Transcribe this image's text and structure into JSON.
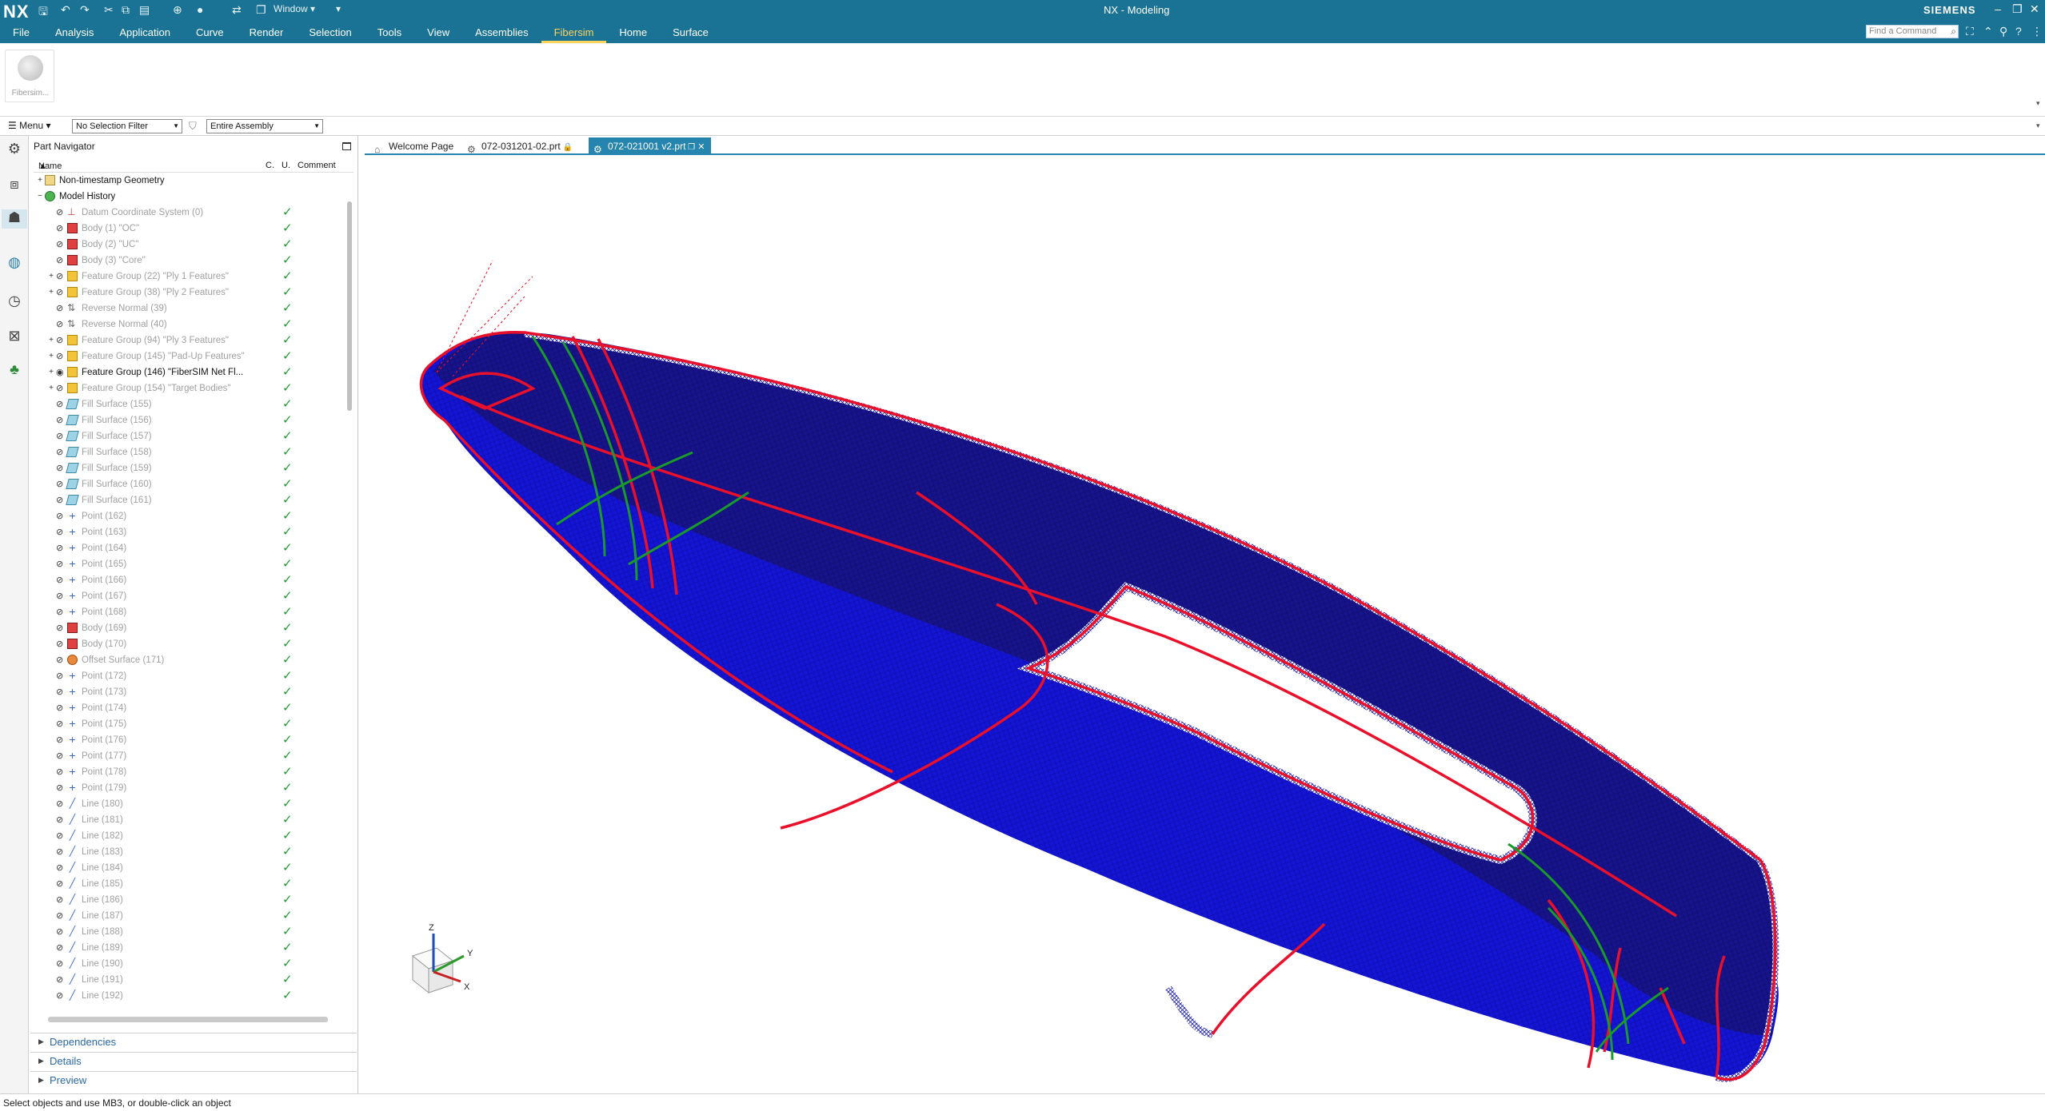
{
  "titlebar": {
    "logo": "NX",
    "window_menu": "Window",
    "app_title": "NX - Modeling",
    "brand": "SIEMENS",
    "find_command_placeholder": "Find a Command"
  },
  "menu_tabs": [
    "File",
    "Analysis",
    "Application",
    "Curve",
    "Render",
    "Selection",
    "Tools",
    "View",
    "Assemblies",
    "Fibersim",
    "Home",
    "Surface"
  ],
  "active_tab": "Fibersim",
  "ribbon": {
    "fibersim_button": "Fibersim..."
  },
  "selection_bar": {
    "menu_label": "Menu",
    "filter": "No Selection Filter",
    "scope": "Entire Assembly"
  },
  "part_navigator": {
    "title": "Part Navigator",
    "columns": {
      "name": "Name",
      "c": "C.",
      "u": "U.",
      "comment": "Comment"
    },
    "rows": [
      {
        "name": "Non-timestamp Geometry",
        "icon": "folder",
        "indent": 0,
        "exp": "+",
        "active": true,
        "check": false
      },
      {
        "name": "Model History",
        "icon": "hist",
        "indent": 0,
        "exp": "−",
        "active": true,
        "check": false
      },
      {
        "name": "Datum Coordinate System (0)",
        "icon": "datum",
        "indent": 1,
        "exp": "",
        "active": false,
        "check": true
      },
      {
        "name": "Body (1) \"OC\"",
        "icon": "body",
        "indent": 1,
        "exp": "",
        "active": false,
        "check": true
      },
      {
        "name": "Body (2) \"UC\"",
        "icon": "body",
        "indent": 1,
        "exp": "",
        "active": false,
        "check": true
      },
      {
        "name": "Body (3) \"Core\"",
        "icon": "body",
        "indent": 1,
        "exp": "",
        "active": false,
        "check": true
      },
      {
        "name": "Feature Group (22) \"Ply 1 Features\"",
        "icon": "feat",
        "indent": 1,
        "exp": "+",
        "active": false,
        "check": true
      },
      {
        "name": "Feature Group (38) \"Ply 2 Features\"",
        "icon": "feat",
        "indent": 1,
        "exp": "+",
        "active": false,
        "check": true
      },
      {
        "name": "Reverse Normal (39)",
        "icon": "rev",
        "indent": 1,
        "exp": "",
        "active": false,
        "check": true
      },
      {
        "name": "Reverse Normal (40)",
        "icon": "rev",
        "indent": 1,
        "exp": "",
        "active": false,
        "check": true
      },
      {
        "name": "Feature Group (94) \"Ply 3 Features\"",
        "icon": "feat",
        "indent": 1,
        "exp": "+",
        "active": false,
        "check": true
      },
      {
        "name": "Feature Group (145) \"Pad-Up Features\"",
        "icon": "feat",
        "indent": 1,
        "exp": "+",
        "active": false,
        "check": true
      },
      {
        "name": "Feature Group (146) \"FiberSIM Net Fl...",
        "icon": "feat",
        "indent": 1,
        "exp": "+",
        "active": true,
        "check": true
      },
      {
        "name": "Feature Group (154) \"Target Bodies\"",
        "icon": "feat",
        "indent": 1,
        "exp": "+",
        "active": false,
        "check": true
      },
      {
        "name": "Fill Surface (155)",
        "icon": "fill",
        "indent": 1,
        "exp": "",
        "active": false,
        "check": true
      },
      {
        "name": "Fill Surface (156)",
        "icon": "fill",
        "indent": 1,
        "exp": "",
        "active": false,
        "check": true
      },
      {
        "name": "Fill Surface (157)",
        "icon": "fill",
        "indent": 1,
        "exp": "",
        "active": false,
        "check": true
      },
      {
        "name": "Fill Surface (158)",
        "icon": "fill",
        "indent": 1,
        "exp": "",
        "active": false,
        "check": true
      },
      {
        "name": "Fill Surface (159)",
        "icon": "fill",
        "indent": 1,
        "exp": "",
        "active": false,
        "check": true
      },
      {
        "name": "Fill Surface (160)",
        "icon": "fill",
        "indent": 1,
        "exp": "",
        "active": false,
        "check": true
      },
      {
        "name": "Fill Surface (161)",
        "icon": "fill",
        "indent": 1,
        "exp": "",
        "active": false,
        "check": true
      },
      {
        "name": "Point (162)",
        "icon": "pt",
        "indent": 1,
        "exp": "",
        "active": false,
        "check": true
      },
      {
        "name": "Point (163)",
        "icon": "pt",
        "indent": 1,
        "exp": "",
        "active": false,
        "check": true
      },
      {
        "name": "Point (164)",
        "icon": "pt",
        "indent": 1,
        "exp": "",
        "active": false,
        "check": true
      },
      {
        "name": "Point (165)",
        "icon": "pt",
        "indent": 1,
        "exp": "",
        "active": false,
        "check": true
      },
      {
        "name": "Point (166)",
        "icon": "pt",
        "indent": 1,
        "exp": "",
        "active": false,
        "check": true
      },
      {
        "name": "Point (167)",
        "icon": "pt",
        "indent": 1,
        "exp": "",
        "active": false,
        "check": true
      },
      {
        "name": "Point (168)",
        "icon": "pt",
        "indent": 1,
        "exp": "",
        "active": false,
        "check": true
      },
      {
        "name": "Body (169)",
        "icon": "body",
        "indent": 1,
        "exp": "",
        "active": false,
        "check": true
      },
      {
        "name": "Body (170)",
        "icon": "body",
        "indent": 1,
        "exp": "",
        "active": false,
        "check": true
      },
      {
        "name": "Offset Surface (171)",
        "icon": "offs",
        "indent": 1,
        "exp": "",
        "active": false,
        "check": true
      },
      {
        "name": "Point (172)",
        "icon": "pt",
        "indent": 1,
        "exp": "",
        "active": false,
        "check": true
      },
      {
        "name": "Point (173)",
        "icon": "pt",
        "indent": 1,
        "exp": "",
        "active": false,
        "check": true
      },
      {
        "name": "Point (174)",
        "icon": "pt",
        "indent": 1,
        "exp": "",
        "active": false,
        "check": true
      },
      {
        "name": "Point (175)",
        "icon": "pt",
        "indent": 1,
        "exp": "",
        "active": false,
        "check": true
      },
      {
        "name": "Point (176)",
        "icon": "pt",
        "indent": 1,
        "exp": "",
        "active": false,
        "check": true
      },
      {
        "name": "Point (177)",
        "icon": "pt",
        "indent": 1,
        "exp": "",
        "active": false,
        "check": true
      },
      {
        "name": "Point (178)",
        "icon": "pt",
        "indent": 1,
        "exp": "",
        "active": false,
        "check": true
      },
      {
        "name": "Point (179)",
        "icon": "pt",
        "indent": 1,
        "exp": "",
        "active": false,
        "check": true
      },
      {
        "name": "Line (180)",
        "icon": "ln",
        "indent": 1,
        "exp": "",
        "active": false,
        "check": true
      },
      {
        "name": "Line (181)",
        "icon": "ln",
        "indent": 1,
        "exp": "",
        "active": false,
        "check": true
      },
      {
        "name": "Line (182)",
        "icon": "ln",
        "indent": 1,
        "exp": "",
        "active": false,
        "check": true
      },
      {
        "name": "Line (183)",
        "icon": "ln",
        "indent": 1,
        "exp": "",
        "active": false,
        "check": true
      },
      {
        "name": "Line (184)",
        "icon": "ln",
        "indent": 1,
        "exp": "",
        "active": false,
        "check": true
      },
      {
        "name": "Line (185)",
        "icon": "ln",
        "indent": 1,
        "exp": "",
        "active": false,
        "check": true
      },
      {
        "name": "Line (186)",
        "icon": "ln",
        "indent": 1,
        "exp": "",
        "active": false,
        "check": true
      },
      {
        "name": "Line (187)",
        "icon": "ln",
        "indent": 1,
        "exp": "",
        "active": false,
        "check": true
      },
      {
        "name": "Line (188)",
        "icon": "ln",
        "indent": 1,
        "exp": "",
        "active": false,
        "check": true
      },
      {
        "name": "Line (189)",
        "icon": "ln",
        "indent": 1,
        "exp": "",
        "active": false,
        "check": true
      },
      {
        "name": "Line (190)",
        "icon": "ln",
        "indent": 1,
        "exp": "",
        "active": false,
        "check": true
      },
      {
        "name": "Line (191)",
        "icon": "ln",
        "indent": 1,
        "exp": "",
        "active": false,
        "check": true
      },
      {
        "name": "Line (192)",
        "icon": "ln",
        "indent": 1,
        "exp": "",
        "active": false,
        "check": true
      }
    ],
    "sections": [
      "Dependencies",
      "Details",
      "Preview"
    ]
  },
  "doc_tabs": [
    {
      "label": "Welcome Page",
      "active": false
    },
    {
      "label": "072-031201-02.prt",
      "active": false
    },
    {
      "label": "072-021001 v2.prt",
      "active": true
    }
  ],
  "triad": {
    "x": "X",
    "y": "Y",
    "z": "Z"
  },
  "colors": {
    "accent": "#1a7394",
    "active_tab": "#ffd35c",
    "mesh_blue": "#1010d8",
    "boundary_red": "#e8102a",
    "ply_green": "#1a9a2a"
  },
  "status": "Select objects and use MB3, or double-click an object"
}
